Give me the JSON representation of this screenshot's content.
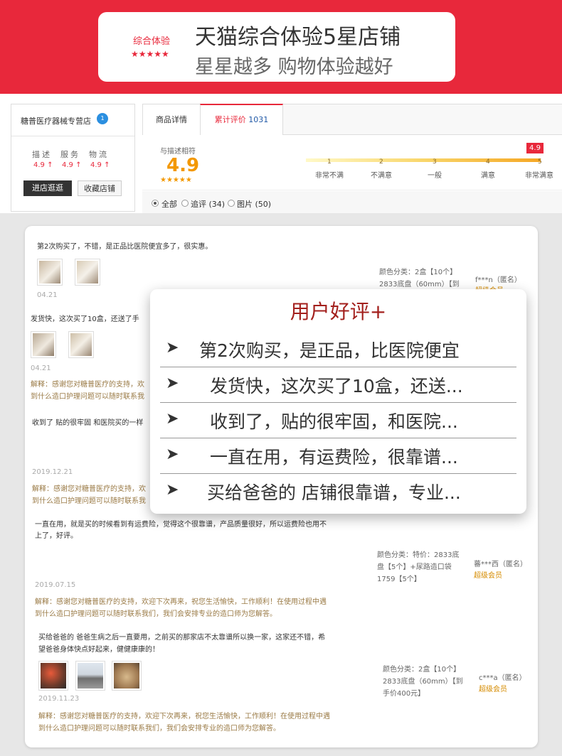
{
  "banner": {
    "badge_text": "综合体验",
    "badge_stars": "★★★★★",
    "title": "天猫综合体验5星店铺",
    "subtitle": "星星越多  购物体验越好"
  },
  "shop": {
    "name": "糖普医疗器械专营店",
    "badge": "1",
    "score_labels": [
      "描述",
      "服务",
      "物流"
    ],
    "scores": [
      "4.9 ↑",
      "4.9 ↑",
      "4.9 ↑"
    ],
    "enter_button": "进店逛逛",
    "favorite_button": "收藏店铺"
  },
  "tabs": {
    "details": "商品详情",
    "reviews": "累计评价",
    "reviews_count": "1031"
  },
  "rating": {
    "label": "与描述相符",
    "score": "4.9",
    "stars": "★★★★★",
    "flag": "4.9",
    "level": 4.9,
    "ticks": [
      "1",
      "2",
      "3",
      "4",
      "5"
    ],
    "tick_labels": [
      "非常不满",
      "不满意",
      "一般",
      "满意",
      "非常满意"
    ]
  },
  "filter": {
    "all": "全部",
    "followup": "追评 (34)",
    "images": "图片 (50)"
  },
  "reviews": [
    {
      "text": "第2次购买了，不错，是正品比医院便宜多了，很实惠。",
      "date": "04.21",
      "meta": "颜色分类：2盒【10个】 2833底盘（60mm）【到",
      "user": "f***n（匿名）",
      "vip": "超级会员"
    },
    {
      "text": "发货快，这次买了10盒，还送了手",
      "date": "04.21",
      "reply": "解释：感谢您对糖普医疗的支持，欢",
      "reply2": "到什么造口护理问题可以随时联系我"
    },
    {
      "text": "收到了 贴的很牢固 和医院买的一样",
      "date": "2019.12.21",
      "reply": "解释：感谢您对糖普医疗的支持，欢",
      "reply2": "到什么造口护理问题可以随时联系我"
    },
    {
      "text": "一直在用，就是买的时候看到有运费险，觉得这个很靠谱，产品质量很好，所以运费险也用不",
      "text2": "上了，好评。",
      "date": "2019.07.15",
      "meta": "颜色分类：特价：2833底 盘【5个】+尿路造口袋 1759【5个】",
      "user": "蕃***西（匿名）",
      "vip": "超级会员",
      "reply": "解释：感谢您对糖普医疗的支持，欢迎下次再来，祝您生活愉快，工作顺利！在使用过程中遇",
      "reply2": "到什么造口护理问题可以随时联系我们，我们会安排专业的造口师为您解答。"
    },
    {
      "text": "买给爸爸的 爸爸生病之后一直要用，之前买的那家店不太靠谱所以换一家，这家还不错，希",
      "text2": "望爸爸身体快点好起来，健健康康的！",
      "date": "2019.11.23",
      "meta": "颜色分类：2盒【10个】 2833底盘（60mm）【到 手价400元】",
      "user": "c***a（匿名）",
      "vip": "超级会员",
      "reply": "解释：感谢您对糖普医疗的支持，欢迎下次再来，祝您生活愉快，工作顺利！在使用过程中遇",
      "reply2": "到什么造口护理问题可以随时联系我们，我们会安排专业的造口师为您解答。"
    }
  ],
  "popup": {
    "title": "用户好评+",
    "items": [
      "第2次购买，是正品，比医院便宜",
      "发货快，这次买了10盒，还送...",
      "收到了，贴的很牢固，和医院...",
      "一直在用，有运费险，很靠谱...",
      "买给爸爸的 店铺很靠谱，专业..."
    ]
  },
  "colors": {
    "brand_red": "#e8283b",
    "rating_orange": "#f39800",
    "popup_title": "#a3201d",
    "reply_brown": "#9a7a45"
  }
}
